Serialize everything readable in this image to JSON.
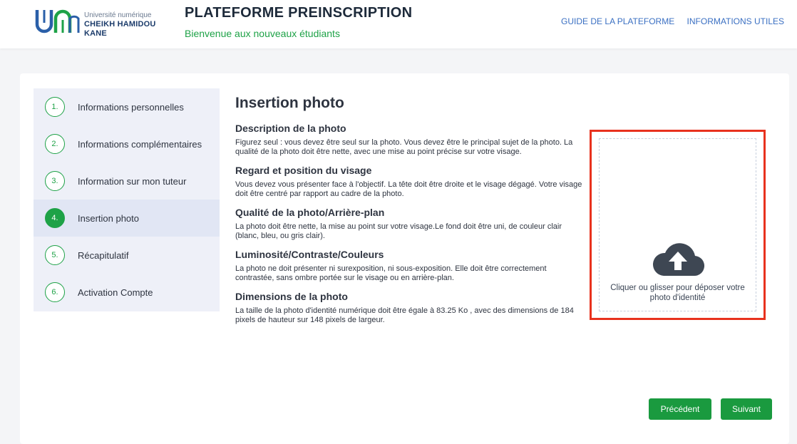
{
  "header": {
    "logo_line1": "Université numérique",
    "logo_line2": "CHEIKH HAMIDOU KANE",
    "title": "PLATEFORME PREINSCRIPTION",
    "subtitle": "Bienvenue aux nouveaux étudiants",
    "nav": [
      "GUIDE DE LA PLATEFORME",
      "INFORMATIONS UTILES"
    ]
  },
  "stepper": {
    "steps": [
      {
        "num": "1.",
        "label": "Informations personnelles"
      },
      {
        "num": "2.",
        "label": "Informations complémentaires"
      },
      {
        "num": "3.",
        "label": "Information sur mon tuteur"
      },
      {
        "num": "4.",
        "label": "Insertion photo"
      },
      {
        "num": "5.",
        "label": "Récapitulatif"
      },
      {
        "num": "6.",
        "label": "Activation Compte"
      }
    ],
    "active_index": 3
  },
  "content": {
    "title": "Insertion photo",
    "sections": [
      {
        "heading": "Description de la photo",
        "text": "Figurez seul : vous devez être seul sur la photo. Vous devez être le principal sujet de la photo. La qualité de la photo doit être nette, avec une mise au point précise sur votre visage."
      },
      {
        "heading": "Regard et position du visage",
        "text": "Vous devez vous présenter face à l'objectif. La tête doit être droite et le visage dégagé. Votre visage doit être centré par rapport au cadre de la photo."
      },
      {
        "heading": "Qualité de la photo/Arrière-plan",
        "text": "La photo doit être nette, la mise au point sur votre visage.Le fond doit être uni, de couleur clair (blanc, bleu, ou gris clair)."
      },
      {
        "heading": "Luminosité/Contraste/Couleurs",
        "text": "La photo ne doit présenter ni surexposition, ni sous-exposition. Elle doit être correctement contrastée, sans ombre portée sur le visage ou en arrière-plan."
      },
      {
        "heading": "Dimensions de la photo",
        "text": "La taille de la photo d'identité numérique doit être égale à 83.25 Ko , avec des dimensions de 184 pixels de hauteur sur 148 pixels de largeur."
      }
    ]
  },
  "upload": {
    "icon": "cloud-upload-icon",
    "text": "Cliquer ou glisser pour déposer votre photo d'identité"
  },
  "buttons": {
    "prev": "Précédent",
    "next": "Suivant"
  },
  "colors": {
    "accent_green": "#1ea247",
    "highlight_red": "#e8321e",
    "link_blue": "#3a6fc2"
  }
}
